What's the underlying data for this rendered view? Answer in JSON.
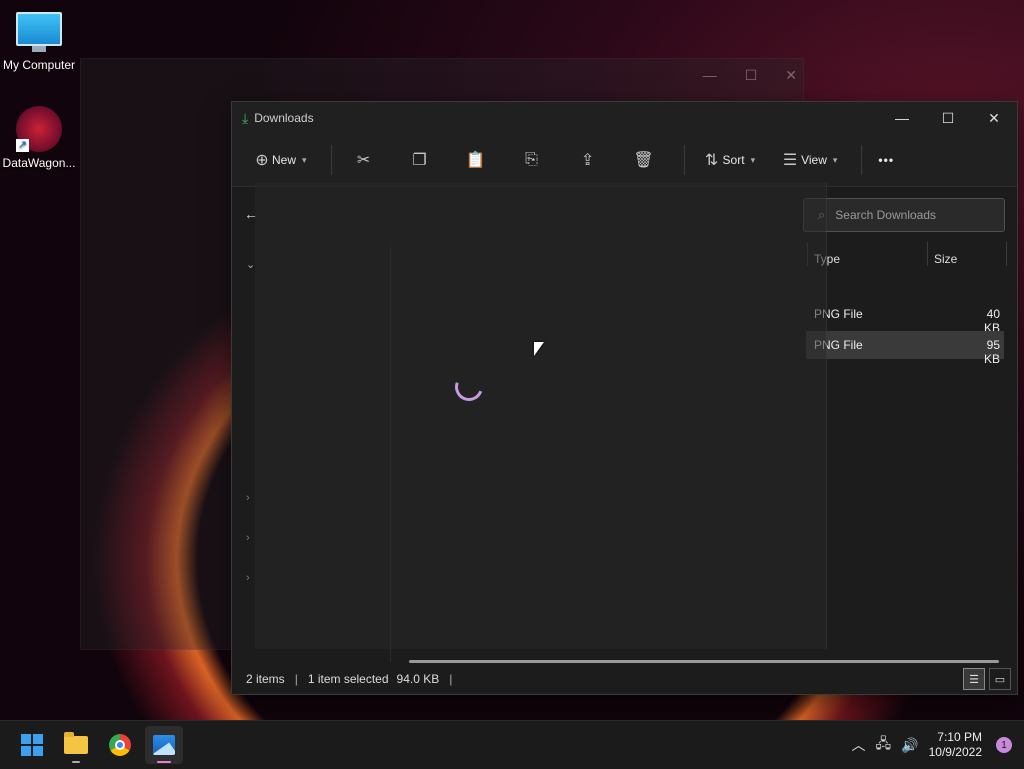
{
  "desktop": {
    "icons": [
      {
        "label": "My Computer"
      },
      {
        "label": "DataWagon..."
      }
    ]
  },
  "explorer": {
    "title": "Downloads",
    "toolbar": {
      "new_label": "New",
      "sort_label": "Sort",
      "view_label": "View",
      "more_label": "•••"
    },
    "search": {
      "placeholder": "Search Downloads"
    },
    "columns": {
      "type": "Type",
      "size": "Size"
    },
    "files": [
      {
        "type": "PNG File",
        "size": "40 KB",
        "selected": false
      },
      {
        "type": "PNG File",
        "size": "95 KB",
        "selected": true
      }
    ],
    "status": {
      "items": "2 items",
      "selection": "1 item selected",
      "selected_size": "94.0 KB"
    }
  },
  "taskbar": {
    "time": "7:10 PM",
    "date": "10/9/2022",
    "notification_count": "1"
  }
}
